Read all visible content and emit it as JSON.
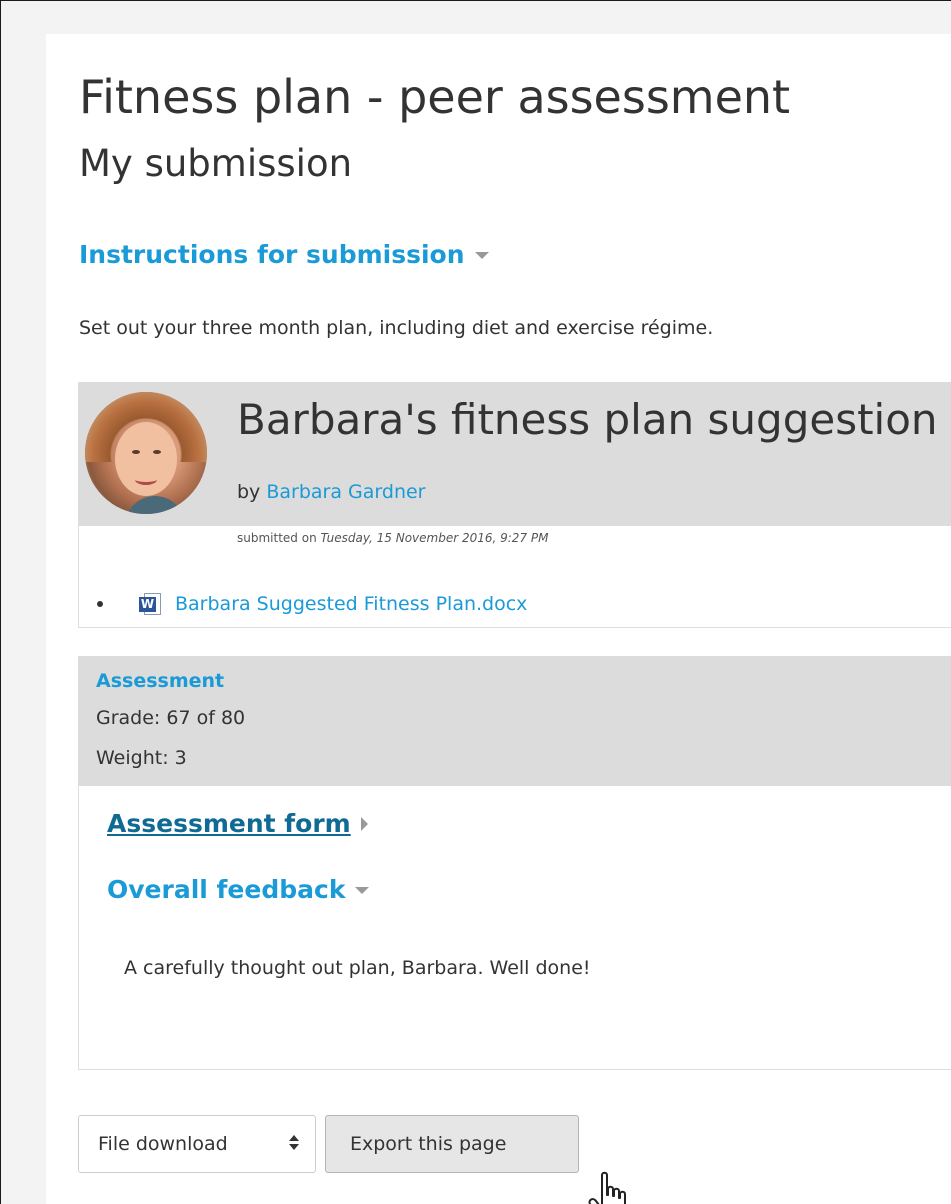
{
  "page": {
    "title": "Fitness plan - peer assessment",
    "subtitle": "My submission"
  },
  "instructions": {
    "toggle_label": "Instructions for submission",
    "text": "Set out your three month plan, including diet and exercise régime."
  },
  "submission": {
    "title": "Barbara's fitness plan suggestion",
    "by_prefix": "by",
    "author": "Barbara Gardner",
    "submitted_prefix": "submitted on",
    "submitted_date": "Tuesday, 15 November 2016, 9:27 PM",
    "attachment": {
      "icon": "word-document-icon",
      "filename": "Barbara Suggested Fitness Plan.docx"
    }
  },
  "assessment": {
    "label": "Assessment",
    "grade": "Grade: 67 of 80",
    "weight": "Weight: 3",
    "form_toggle_label": "Assessment form",
    "feedback_toggle_label": "Overall feedback",
    "feedback_text": "A carefully thought out plan, Barbara. Well done!"
  },
  "controls": {
    "download_select_value": "File download",
    "export_button_label": "Export this page"
  },
  "colors": {
    "link": "#1a9ad6",
    "header_bg": "#dcdcdc",
    "text": "#333333"
  }
}
